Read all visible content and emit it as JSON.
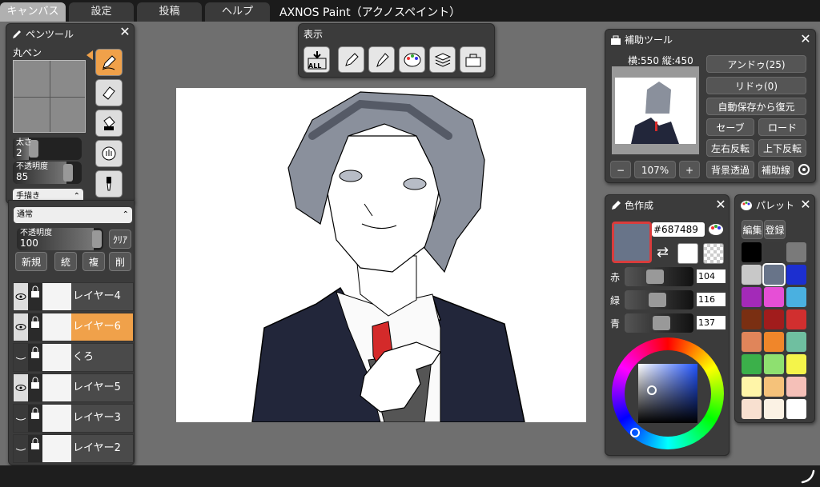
{
  "menubar": {
    "tabs": [
      {
        "label": "キャンバス"
      },
      {
        "label": "設定"
      },
      {
        "label": "投稿"
      },
      {
        "label": "ヘルプ"
      }
    ],
    "app_title": "AXNOS Paint（アクノスペイント）"
  },
  "pen_panel": {
    "title": "ペンツール",
    "pen_name": "丸ペン",
    "size_label": "太さ",
    "size_value": "2",
    "opacity_label": "不透明度",
    "opacity_value": "85",
    "opacity_fraction": 0.85,
    "mode_value": "手描き"
  },
  "layer_panel": {
    "blend_value": "通常",
    "opacity_label": "不透明度",
    "opacity_value": "100",
    "clear_label": "ｸﾘｱ",
    "buttons": [
      "新規",
      "統",
      "複",
      "削"
    ],
    "layers": [
      {
        "name": "レイヤー4",
        "visible": true,
        "active": false
      },
      {
        "name": "レイヤー6",
        "visible": true,
        "active": true
      },
      {
        "name": "くろ",
        "visible": false,
        "active": false
      },
      {
        "name": "レイヤー5",
        "visible": true,
        "active": false
      },
      {
        "name": "レイヤー3",
        "visible": false,
        "active": false
      },
      {
        "name": "レイヤー2",
        "visible": false,
        "active": false
      }
    ]
  },
  "display_bar": {
    "title": "表示",
    "fit_label": "ALL"
  },
  "aux_panel": {
    "title": "補助ツール",
    "size_text": "横:550 縦:450",
    "zoom_value": "107%",
    "zoom_minus": "−",
    "zoom_plus": "+",
    "undo_label": "アンドゥ(25)",
    "redo_label": "リドゥ(0)",
    "restore_label": "自動保存から復元",
    "save_label": "セーブ",
    "load_label": "ロード",
    "flip_h_label": "左右反転",
    "flip_v_label": "上下反転",
    "bg_transparent_label": "背景透過",
    "guide_label": "補助線"
  },
  "color_panel": {
    "title": "色作成",
    "hex_value": "#687489",
    "current_color": "#687489",
    "red_label": "赤",
    "green_label": "緑",
    "blue_label": "青",
    "red_value": "104",
    "green_value": "116",
    "blue_value": "137"
  },
  "palette_panel": {
    "title": "パレット",
    "edit_label": "編集",
    "register_label": "登録",
    "swatches": [
      "#000000",
      "#3a3a3a",
      "#7a7a7a",
      "#c8c8c8",
      "#687489",
      "#1c2fd0",
      "#a32ab8",
      "#e64fd6",
      "#4ab0e0",
      "#7a2f12",
      "#a11c1c",
      "#d12f2f",
      "#e0855a",
      "#f0862a",
      "#6fbfa0",
      "#3bb04a",
      "#8ee070",
      "#f4f44a",
      "#fff5a8",
      "#f5c27a",
      "#f5c0b8",
      "#f8e0d0",
      "#fbf2e4",
      "#ffffff"
    ]
  },
  "colors": {
    "accent_orange": "#f0a14a",
    "panel_bg": "#3b3b3b",
    "workspace_bg": "#6f6f6f"
  }
}
